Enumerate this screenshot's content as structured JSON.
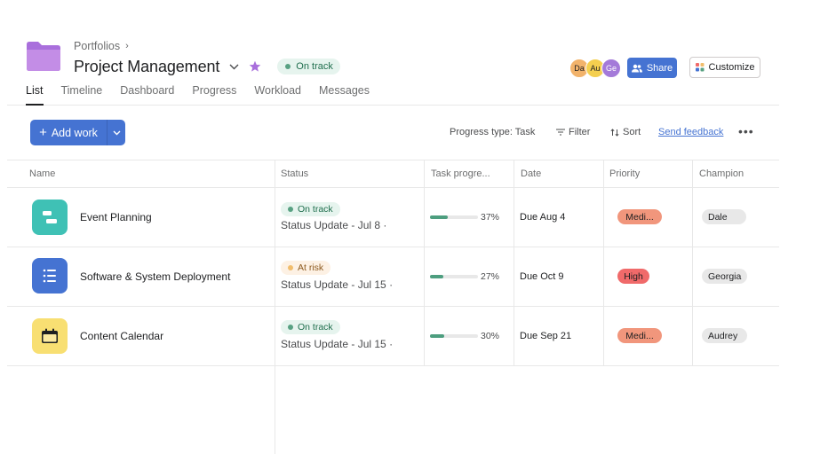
{
  "header": {
    "breadcrumb": "Portfolios",
    "title": "Project Management",
    "status": "On track",
    "share_label": "Share",
    "customize_label": "Customize",
    "avatars": [
      {
        "initials": "Da",
        "color": "#f2b36b"
      },
      {
        "initials": "Au",
        "color": "#f4cf4f"
      },
      {
        "initials": "Ge",
        "color": "#a47ad9"
      }
    ]
  },
  "tabs": [
    {
      "label": "List",
      "active": true
    },
    {
      "label": "Timeline",
      "active": false
    },
    {
      "label": "Dashboard",
      "active": false
    },
    {
      "label": "Progress",
      "active": false
    },
    {
      "label": "Workload",
      "active": false
    },
    {
      "label": "Messages",
      "active": false
    }
  ],
  "toolbar": {
    "add_work_label": "Add work",
    "progress_type": "Progress type: Task",
    "filter_label": "Filter",
    "sort_label": "Sort",
    "feedback_label": "Send feedback",
    "more_label": "•••"
  },
  "columns": [
    "Name",
    "Status",
    "Task progre...",
    "Date",
    "Priority",
    "Champion"
  ],
  "rows": [
    {
      "name": "Event Planning",
      "icon": "timeline-icon",
      "icon_color": "#3fc1b5",
      "status": "On track",
      "status_kind": "ontrack",
      "update": "Status Update - Jul 8 ·",
      "progress": 37,
      "progress_label": "37%",
      "date": "Due Aug 4",
      "priority": "Medi...",
      "priority_color": "#f1967c",
      "champion": "Dale"
    },
    {
      "name": "Software & System Deployment",
      "icon": "list-icon",
      "icon_color": "#4573d2",
      "status": "At risk",
      "status_kind": "atrisk",
      "update": "Status Update - Jul 15 ·",
      "progress": 27,
      "progress_label": "27%",
      "date": "Due Oct 9",
      "priority": "High",
      "priority_color": "#f06a6a",
      "champion": "Georgia"
    },
    {
      "name": "Content Calendar",
      "icon": "calendar-icon",
      "icon_color": "#f8df72",
      "status": "On track",
      "status_kind": "ontrack",
      "update": "Status Update - Jul 15 ·",
      "progress": 30,
      "progress_label": "30%",
      "date": "Due Sep 21",
      "priority": "Medi...",
      "priority_color": "#f1967c",
      "champion": "Audrey"
    }
  ],
  "colors": {
    "accent": "#4573d2",
    "ontrack_bg": "#e6f4ee",
    "ontrack_fg": "#1f6e4d",
    "ontrack_dot": "#58a182",
    "atrisk_bg": "#fdf1e4",
    "atrisk_fg": "#8d5a1e",
    "atrisk_dot": "#f1bd6c"
  }
}
